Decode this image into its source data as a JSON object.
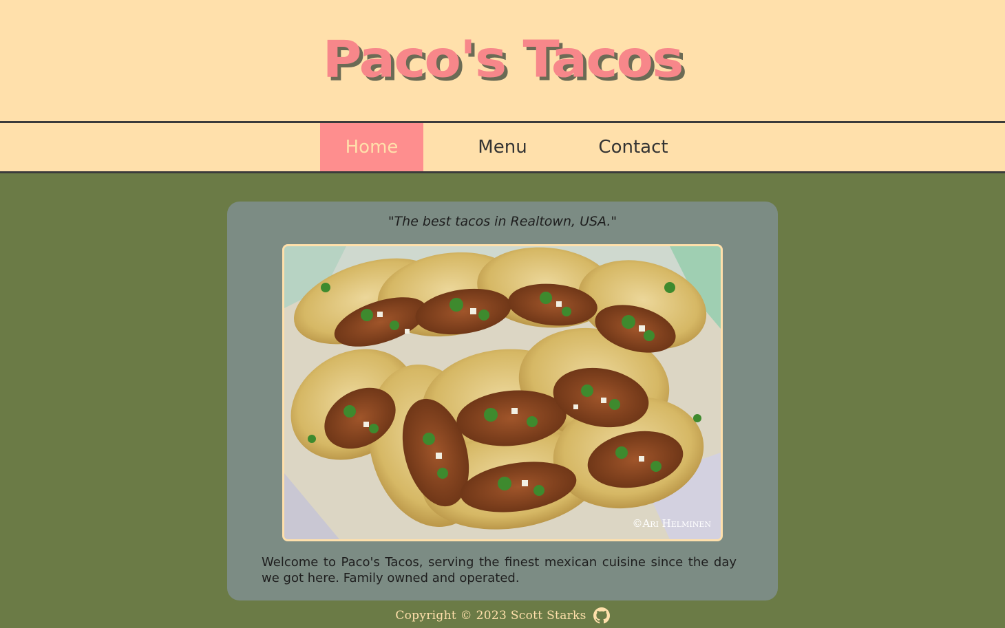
{
  "header": {
    "title": "Paco's Tacos"
  },
  "nav": {
    "items": [
      {
        "label": "Home",
        "active": true
      },
      {
        "label": "Menu",
        "active": false
      },
      {
        "label": "Contact",
        "active": false
      }
    ]
  },
  "main": {
    "tagline": "\"The best tacos in Realtown, USA.\"",
    "image": {
      "watermark": "©Ari Helminen",
      "subject": "tacos-photo"
    },
    "welcome_text": "Welcome to Paco's Tacos, serving the finest mexican cuisine since the day we got here.  Family owned and operated."
  },
  "footer": {
    "copyright": "Copyright © 2023 Scott Starks",
    "icon": "github-icon"
  },
  "colors": {
    "background": "#6b7b46",
    "header_bg": "#ffe0ab",
    "accent": "#fe8e8e",
    "card_bg": "#7c8c84",
    "text_dark": "#333333"
  }
}
